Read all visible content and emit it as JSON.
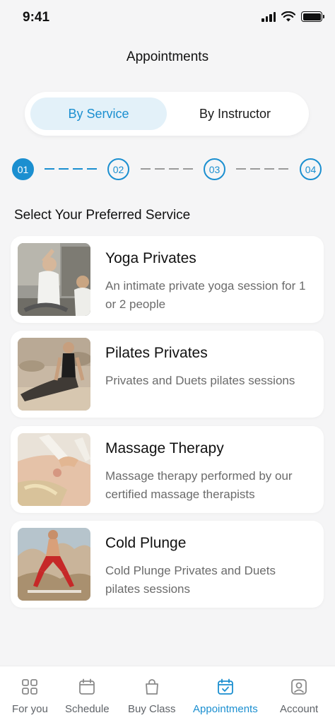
{
  "status_bar": {
    "time": "9:41"
  },
  "header": {
    "title": "Appointments"
  },
  "segmented": {
    "by_service": "By Service",
    "by_instructor": "By Instructor",
    "selected": "By Service"
  },
  "stepper": {
    "steps": [
      "01",
      "02",
      "03",
      "04"
    ],
    "current": 1
  },
  "section": {
    "heading": "Select Your Preferred Service"
  },
  "services": [
    {
      "title": "Yoga Privates",
      "desc": "An intimate private yoga session for 1 or 2 people",
      "image_icon": "yoga-photo"
    },
    {
      "title": "Pilates Privates",
      "desc": "Privates and Duets pilates sessions",
      "image_icon": "pilates-photo"
    },
    {
      "title": "Massage Therapy",
      "desc": "Massage therapy performed by our certified massage therapists",
      "image_icon": "massage-photo"
    },
    {
      "title": "Cold Plunge",
      "desc": "Cold Plunge Privates and Duets pilates sessions",
      "image_icon": "cold-plunge-photo"
    }
  ],
  "tabbar": {
    "items": [
      {
        "label": "For you",
        "icon": "grid-icon"
      },
      {
        "label": "Schedule",
        "icon": "calendar-icon"
      },
      {
        "label": "Buy Class",
        "icon": "bag-icon"
      },
      {
        "label": "Appointments",
        "icon": "calendar-check-icon"
      },
      {
        "label": "Account",
        "icon": "account-icon"
      }
    ],
    "active": "Appointments"
  },
  "colors": {
    "accent": "#1b8fd0",
    "accent_light": "#e3f1f9",
    "background": "#f5f5f6"
  }
}
